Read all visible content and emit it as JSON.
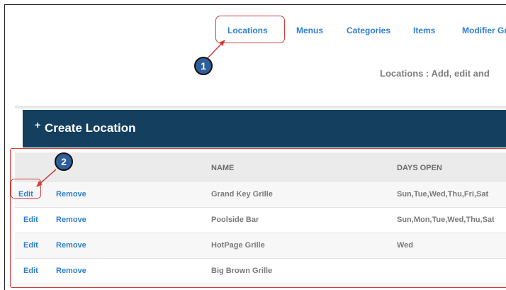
{
  "nav": {
    "items": [
      {
        "label": "Locations"
      },
      {
        "label": "Menus"
      },
      {
        "label": "Categories"
      },
      {
        "label": "Items"
      },
      {
        "label": "Modifier Gr"
      }
    ]
  },
  "page": {
    "subtitle": "Locations :  Add, edit and"
  },
  "panel": {
    "plus": "+",
    "title": "Create Location"
  },
  "table": {
    "headers": {
      "name": "NAME",
      "days": "DAYS OPEN"
    },
    "rows": [
      {
        "edit": "Edit",
        "remove": "Remove",
        "name": "Grand Key Grille",
        "days": "Sun,Tue,Wed,Thu,Fri,Sat"
      },
      {
        "edit": "Edit",
        "remove": "Remove",
        "name": "Poolside Bar",
        "days": "Sun,Mon,Tue,Wed,Thu,Sat"
      },
      {
        "edit": "Edit",
        "remove": "Remove",
        "name": "HotPage Grille",
        "days": "Wed"
      },
      {
        "edit": "Edit",
        "remove": "Remove",
        "name": "Big Brown Grille",
        "days": ""
      }
    ]
  },
  "annotations": {
    "badge1": "1",
    "badge2": "2"
  },
  "colors": {
    "accent": "#2f7fd1",
    "panel": "#143f5f",
    "annotation": "#d43b3b",
    "badge": "#2d5f9c"
  }
}
